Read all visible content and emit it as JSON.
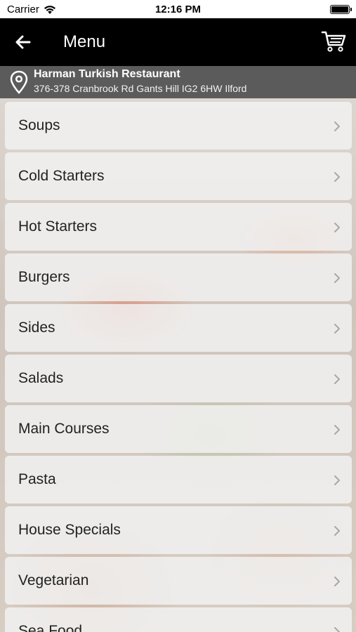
{
  "status_bar": {
    "carrier": "Carrier",
    "time": "12:16 PM",
    "icons": [
      "wifi-icon",
      "battery-icon"
    ]
  },
  "nav_bar": {
    "title": "Menu",
    "background": "#000000",
    "icons": [
      "back-arrow-icon",
      "cart-icon"
    ]
  },
  "location": {
    "name": "Harman Turkish Restaurant",
    "address": "376-378 Cranbrook Rd Gants Hill IG2 6HW Ilford",
    "background": "#5b5b5b",
    "icon": "location-pin-icon"
  },
  "menu": {
    "items": [
      {
        "label": "Soups"
      },
      {
        "label": "Cold Starters"
      },
      {
        "label": "Hot Starters"
      },
      {
        "label": "Burgers"
      },
      {
        "label": "Sides"
      },
      {
        "label": "Salads"
      },
      {
        "label": "Main Courses"
      },
      {
        "label": "Pasta"
      },
      {
        "label": "House Specials"
      },
      {
        "label": "Vegetarian"
      },
      {
        "label": "Sea Food"
      }
    ],
    "item_icon": "chevron-right-icon"
  }
}
